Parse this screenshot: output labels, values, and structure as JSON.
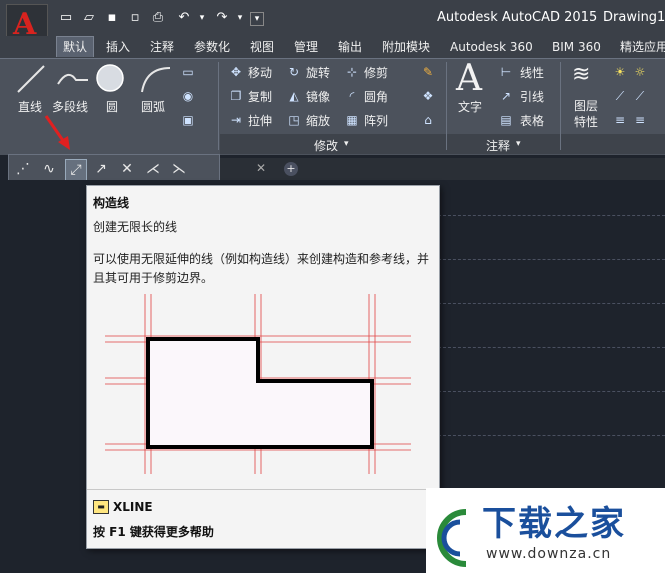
{
  "title_bar": {
    "app_name": "Autodesk AutoCAD 2015",
    "document": "Drawing1.",
    "logo_letter": "A",
    "colors": {
      "logo": "#d8231f",
      "bar": "#3b4048"
    }
  },
  "tabs": [
    {
      "label": "默认",
      "active": true
    },
    {
      "label": "插入"
    },
    {
      "label": "注释"
    },
    {
      "label": "参数化"
    },
    {
      "label": "视图"
    },
    {
      "label": "管理"
    },
    {
      "label": "输出"
    },
    {
      "label": "附加模块"
    },
    {
      "label": "Autodesk 360"
    },
    {
      "label": "BIM 360"
    },
    {
      "label": "精选应用"
    }
  ],
  "ribbon": {
    "draw": {
      "line": "直线",
      "polyline": "多段线",
      "circle": "圆",
      "arc": "圆弧"
    },
    "modify": {
      "title": "修改",
      "move": "移动",
      "rotate": "旋转",
      "trim": "修剪",
      "copy": "复制",
      "mirror": "镜像",
      "fillet": "圆角",
      "stretch": "拉伸",
      "scale": "缩放",
      "array": "阵列"
    },
    "annotation": {
      "title": "注释",
      "text": "文字",
      "linear": "线性",
      "leader": "引线",
      "table": "表格"
    },
    "layers": {
      "layer_properties": "图层\n特性"
    }
  },
  "tooltip": {
    "title": "构造线",
    "subtitle": "创建无限长的线",
    "description": "可以使用无限延伸的线（例如构造线）来创建构造和参考线，并且其可用于修剪边界。",
    "command": "XLINE",
    "help": "按 F1 键获得更多帮助"
  },
  "watermark": {
    "text": "下载之家",
    "url": "www.downza.cn",
    "color": "#1a4f9c"
  }
}
